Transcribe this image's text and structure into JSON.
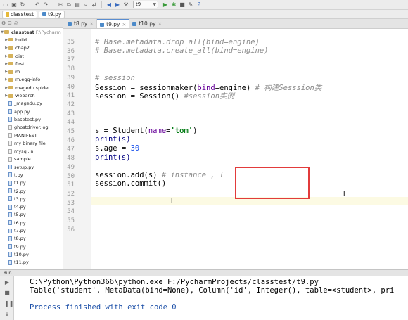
{
  "toolbar": {
    "run_config": "t9",
    "icons": [
      "open-icon",
      "save-icon",
      "sync-icon",
      "back-icon",
      "forward-icon",
      "cut-icon",
      "copy-icon",
      "paste-icon",
      "search-icon",
      "replace-icon",
      "nav-back-icon",
      "nav-forward-icon",
      "build-icon",
      "run-icon",
      "debug-icon",
      "stop-icon",
      "vcs-icon",
      "help-icon"
    ]
  },
  "breadcrumb": {
    "project": "classtest",
    "file": "t9.py"
  },
  "project_panel": {
    "header_label": "classtest",
    "root_name": "classtest",
    "root_path": "F:\\Pycharm",
    "items": [
      {
        "label": "build",
        "type": "folder"
      },
      {
        "label": "chap2",
        "type": "folder"
      },
      {
        "label": "dist",
        "type": "folder"
      },
      {
        "label": "first",
        "type": "folder"
      },
      {
        "label": "m",
        "type": "folder"
      },
      {
        "label": "m.egg-info",
        "type": "folder"
      },
      {
        "label": "magedu spider",
        "type": "folder"
      },
      {
        "label": "webarch",
        "type": "folder"
      },
      {
        "label": "_magedu.py",
        "type": "py"
      },
      {
        "label": "app.py",
        "type": "py"
      },
      {
        "label": "basetest.py",
        "type": "py"
      },
      {
        "label": "ghostdriver.log",
        "type": "file"
      },
      {
        "label": "MANIFEST",
        "type": "file"
      },
      {
        "label": "my binary file",
        "type": "file"
      },
      {
        "label": "mysql.ini",
        "type": "file"
      },
      {
        "label": "sample",
        "type": "file"
      },
      {
        "label": "setup.py",
        "type": "py"
      },
      {
        "label": "t.py",
        "type": "py"
      },
      {
        "label": "t1.py",
        "type": "py"
      },
      {
        "label": "t2.py",
        "type": "py"
      },
      {
        "label": "t3.py",
        "type": "py"
      },
      {
        "label": "t4.py",
        "type": "py"
      },
      {
        "label": "t5.py",
        "type": "py"
      },
      {
        "label": "t6.py",
        "type": "py"
      },
      {
        "label": "t7.py",
        "type": "py"
      },
      {
        "label": "t8.py",
        "type": "py"
      },
      {
        "label": "t9.py",
        "type": "py"
      },
      {
        "label": "t10.py",
        "type": "py"
      },
      {
        "label": "t11.py",
        "type": "py"
      }
    ]
  },
  "tabs": [
    {
      "label": "t8.py",
      "active": false
    },
    {
      "label": "t9.py",
      "active": true
    },
    {
      "label": "t10.py",
      "active": false
    }
  ],
  "editor": {
    "line_numbers": [
      "35",
      "36",
      "37",
      "38",
      "39",
      "40",
      "41",
      "42",
      "43",
      "44",
      "45",
      "46",
      "47",
      "48",
      "49",
      "50",
      "51",
      "52",
      "53",
      "54",
      "55",
      "56"
    ],
    "lines": {
      "l35": "# Base.metadata.drop_all(bind=engine)",
      "l36": "# Base.metadata.create_all(bind=engine)",
      "l39": "# session",
      "l40_a": "Session = sessionmaker(",
      "l40_b": "bind",
      "l40_c": "=engine) ",
      "l40_d": "# 构建Sesssion类",
      "l41_a": "session = Session() ",
      "l41_b": "#session实例",
      "l46_a": "s = Student(",
      "l46_b": "name",
      "l46_c": "=",
      "l46_d": "'tom'",
      "l46_e": ")",
      "l47": "print(s)",
      "l48_a": "s.age = ",
      "l48_b": "30",
      "l49": "print(s)",
      "l51_a": "session.add(s) ",
      "l51_b": "# instance , I",
      "l52": "session.commit()"
    }
  },
  "run_panel": {
    "title": "Run",
    "command": "C:\\Python\\Python366\\python.exe F:/PycharmProjects/classtest/t9.py",
    "output": "Table('student', MetaData(bind=None), Column('id', Integer(), table=<student>, pri",
    "exit": "Process finished with exit code 0"
  }
}
